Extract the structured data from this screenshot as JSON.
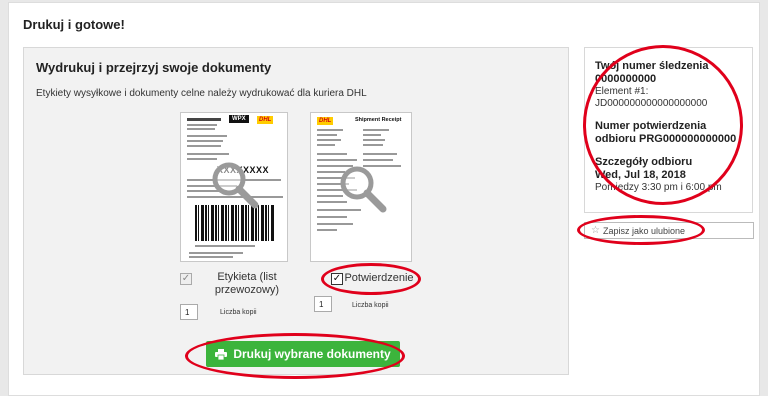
{
  "page": {
    "title": "Drukuj i gotowe!"
  },
  "main": {
    "title": "Wydrukuj i przejrzyj swoje dokumenty",
    "description": "Etykiety wysyłkowe i dokumenty celne należy wydrukować dla kuriera DHL",
    "documents": [
      {
        "name": "Etykieta (list przewozowy)",
        "checked": true,
        "copies": "1",
        "copies_label": "Liczba kopii"
      },
      {
        "name": "Potwierdzenie",
        "checked": true,
        "copies": "1",
        "copies_label": "Liczba kopii"
      }
    ],
    "label_preview": {
      "brand": "DHL",
      "service": "WPX",
      "code": "XXXXXXXX"
    },
    "receipt_preview": {
      "brand": "DHL",
      "heading": "Shipment Receipt"
    },
    "print_button": "Drukuj wybrane dokumenty"
  },
  "side": {
    "tracking_heading": "Twój numer śledzenia",
    "tracking_number": "0000000000",
    "element_label": "Element #1:",
    "element_value": "JD000000000000000000",
    "pickup_confirm_heading": "Numer potwierdzenia",
    "pickup_confirm_value": "odbioru PRG000000000000",
    "pickup_details_heading": "Szczegóły odbioru",
    "pickup_date": "Wed, Jul 18, 2018",
    "pickup_time": "Pomiędzy 3:30 pm i 6:00 pm"
  },
  "favorite_button": "Zapisz jako ulubione",
  "colors": {
    "accent_green": "#3cb43c",
    "annotation_red": "#e0001b",
    "dhl_yellow": "#ffcc00",
    "dhl_red": "#d40511"
  }
}
